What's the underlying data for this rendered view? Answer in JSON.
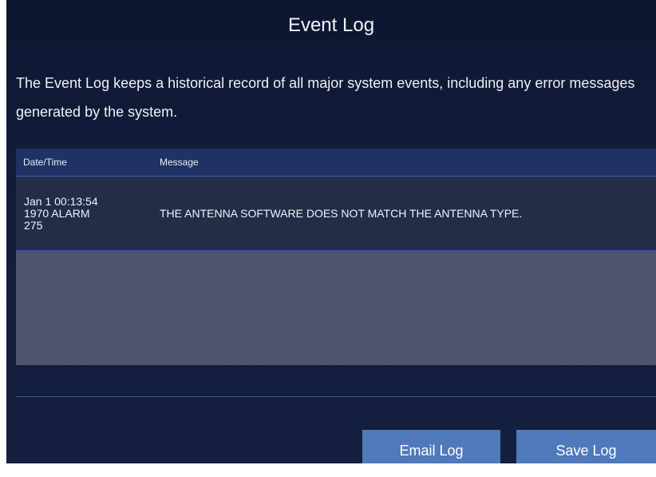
{
  "header": {
    "title": "Event Log"
  },
  "description": "The Event Log keeps a historical record of all major system events, including any error messages generated by the system.",
  "table": {
    "columns": {
      "datetime": "Date/Time",
      "message": "Message"
    },
    "rows": [
      {
        "datetime_line1": "Jan 1 00:13:54",
        "datetime_line2": "1970 ALARM",
        "datetime_line3": "275",
        "message": "THE ANTENNA SOFTWARE DOES NOT MATCH THE ANTENNA TYPE."
      }
    ]
  },
  "actions": {
    "email_label": "Email Log",
    "save_label": "Save Log"
  },
  "colors": {
    "background": "#121c3a",
    "header_row": "#1f3263",
    "data_row": "#232d48",
    "empty_area": "#4e536f",
    "button": "#4f79ba"
  }
}
